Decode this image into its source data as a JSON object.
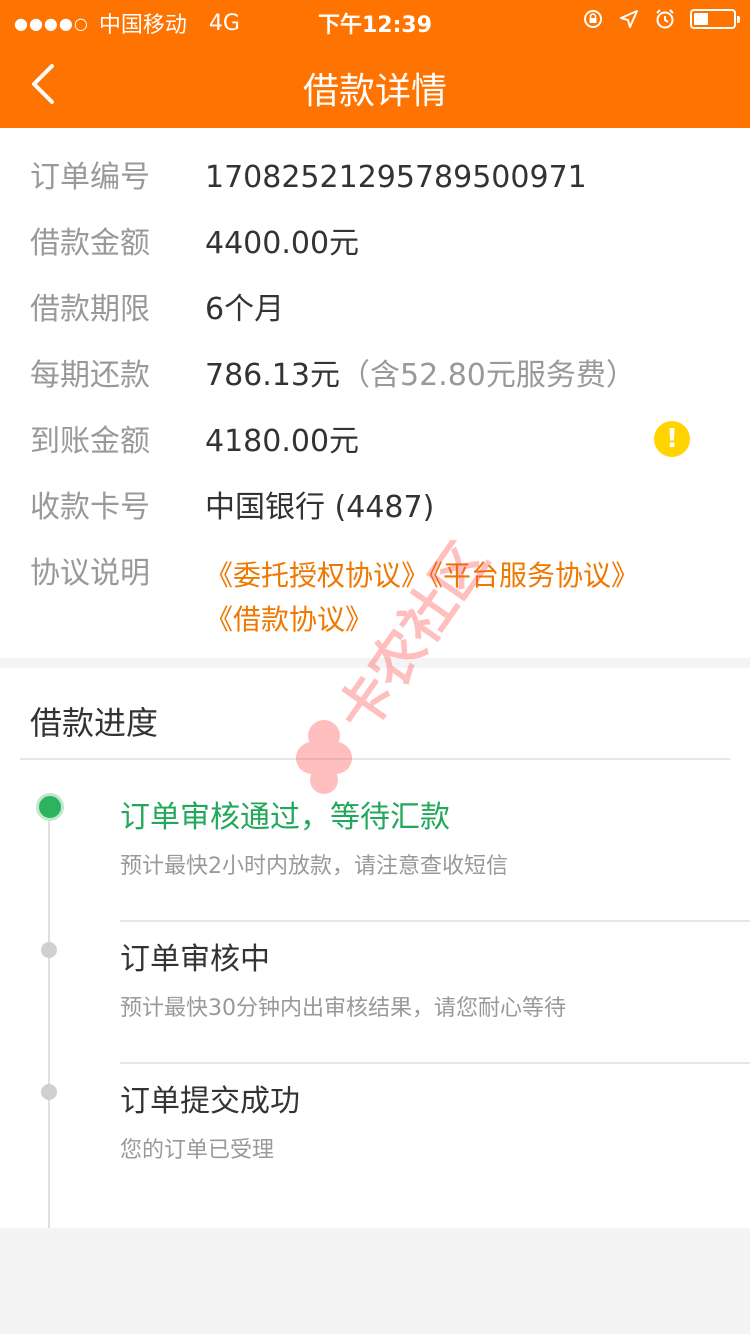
{
  "status_bar": {
    "signal": "●●●●○",
    "carrier": "中国移动",
    "network": "4G",
    "time": "下午12:39"
  },
  "nav": {
    "title": "借款详情"
  },
  "details": [
    {
      "label": "订单编号",
      "value": "17082521295789500971",
      "note": ""
    },
    {
      "label": "借款金额",
      "value": "4400.00元",
      "note": ""
    },
    {
      "label": "借款期限",
      "value": "6个月",
      "note": ""
    },
    {
      "label": "每期还款",
      "value": "786.13元",
      "note": "（含52.80元服务费）"
    },
    {
      "label": "到账金额",
      "value": "4180.00元",
      "note": ""
    },
    {
      "label": "收款卡号",
      "value": "中国银行 (4487)",
      "note": ""
    },
    {
      "label": "协议说明",
      "value": "",
      "note": ""
    }
  ],
  "warning_icon": "!",
  "agreements": [
    "《委托授权协议》",
    "《平台服务协议》",
    "《借款协议》"
  ],
  "progress": {
    "title": "借款进度",
    "steps": [
      {
        "title": "订单审核通过，等待汇款",
        "subtitle": "预计最快2小时内放款，请注意查收短信",
        "active": true
      },
      {
        "title": "订单审核中",
        "subtitle": "预计最快30分钟内出审核结果，请您耐心等待",
        "active": false
      },
      {
        "title": "订单提交成功",
        "subtitle": "您的订单已受理",
        "active": false
      }
    ]
  },
  "watermark_text": "卡农社区",
  "colors": {
    "brand": "#ff7300",
    "link": "#f07800",
    "success": "#22a85a",
    "warning": "#ffd400"
  }
}
